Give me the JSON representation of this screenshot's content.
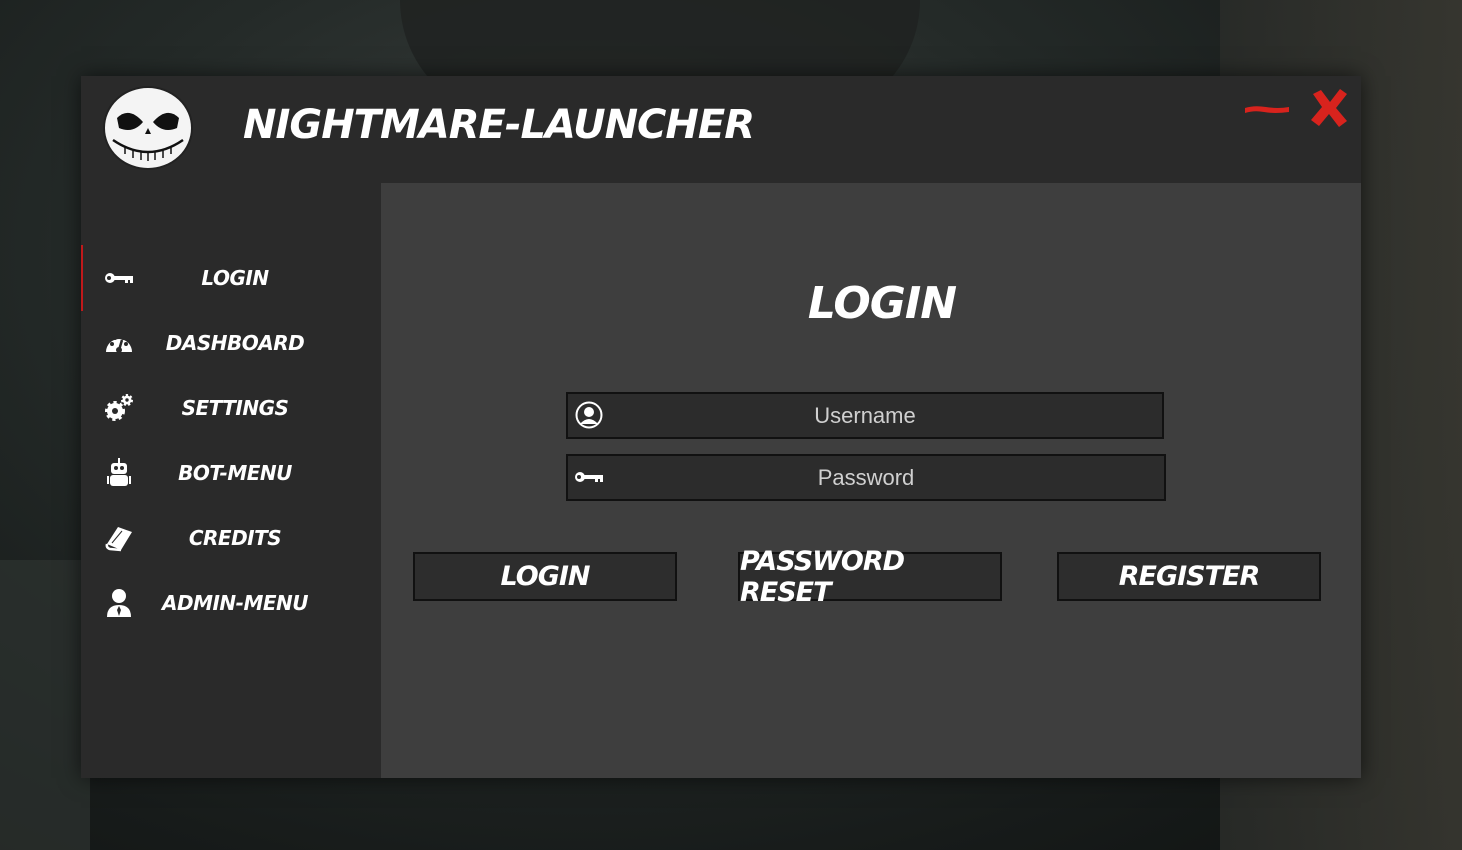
{
  "app": {
    "title": "NIGHTMARE-LAUNCHER",
    "logo_icon": "skull-face-icon",
    "minimize_icon": "minimize-icon",
    "close_icon": "close-icon",
    "accent_color": "#d8231d"
  },
  "sidebar": {
    "items": [
      {
        "label": "LOGIN",
        "icon": "key-icon",
        "active": true
      },
      {
        "label": "DASHBOARD",
        "icon": "dashboard-gauge-icon",
        "active": false
      },
      {
        "label": "SETTINGS",
        "icon": "gears-icon",
        "active": false
      },
      {
        "label": "BOT-MENU",
        "icon": "robot-icon",
        "active": false
      },
      {
        "label": "CREDITS",
        "icon": "book-icon",
        "active": false
      },
      {
        "label": "ADMIN-MENU",
        "icon": "admin-user-icon",
        "active": false
      }
    ]
  },
  "main": {
    "title": "LOGIN",
    "username": {
      "placeholder": "Username",
      "value": "",
      "icon": "user-circle-icon"
    },
    "password": {
      "placeholder": "Password",
      "value": "",
      "icon": "key-icon"
    },
    "buttons": {
      "login": "LOGIN",
      "reset": "PASSWORD RESET",
      "register": "REGISTER"
    }
  }
}
